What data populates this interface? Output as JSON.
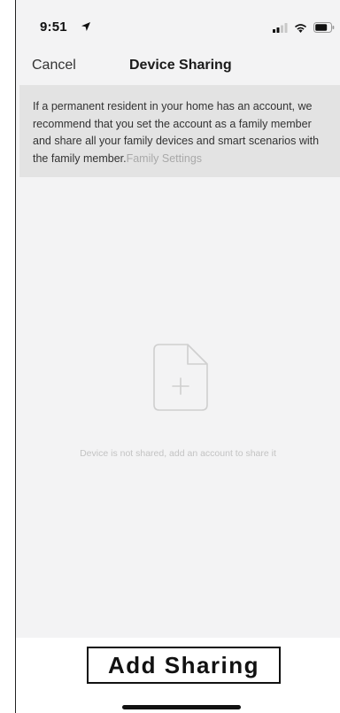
{
  "status_bar": {
    "time": "9:51",
    "icons": [
      "location-arrow-icon",
      "cellular-signal-icon",
      "wifi-icon",
      "battery-icon"
    ]
  },
  "navbar": {
    "cancel_label": "Cancel",
    "title": "Device Sharing"
  },
  "notice": {
    "text": "If a permanent resident in your home has an account, we recommend that you set the account as a family member and share all your family devices and smart scenarios with the family member.",
    "link_label": "Family Settings"
  },
  "empty_state": {
    "icon": "add-document-icon",
    "message": "Device is not shared, add an account to share it"
  },
  "footer": {
    "add_button_label": "Add Sharing"
  },
  "colors": {
    "background": "#f3f3f4",
    "notice_background": "#e3e3e3",
    "link": "#a9a9a9",
    "empty_text": "#c3c3c3"
  }
}
